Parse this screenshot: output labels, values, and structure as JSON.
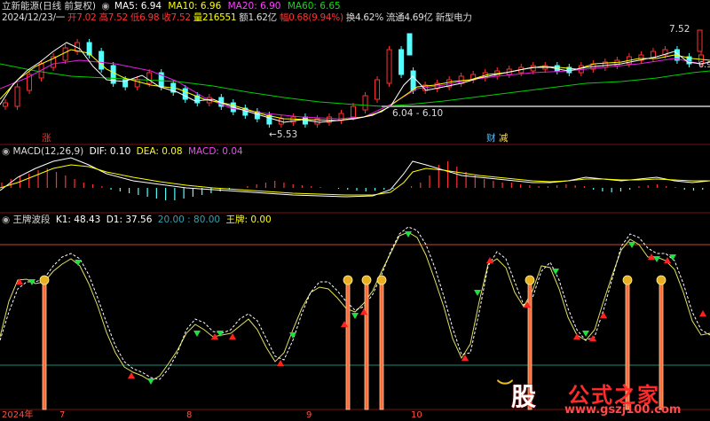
{
  "stock": {
    "title": "立新能源(日线 前复权)",
    "ma5_label": "MA5: 6.94",
    "ma10_label": "MA10: 6.96",
    "ma20_label": "MA20: 6.90",
    "ma60_label": "MA60: 6.65",
    "date": "2024/12/23/一",
    "open": "开7.02",
    "high": "高7.52",
    "low": "低6.98",
    "close": "收7.52",
    "volume": "量216551",
    "amount": "额1.62亿",
    "change": "幅0.68(9.94%)",
    "turnover": "换4.62%",
    "float_cap": "流通4.69亿",
    "sector": "新型电力",
    "price_high_label": "7.52",
    "price_right_label": "6.9",
    "low_label_1": "5.53",
    "low_label_2": "6.04 - 6.10",
    "marker_zhang": "涨",
    "marker_cai": "财",
    "marker_jian": "减"
  },
  "macd": {
    "title": "MACD(12,26,9)",
    "dif": "DIF: 0.10",
    "dea": "DEA: 0.08",
    "macd": "MACD: 0.04"
  },
  "wangpai": {
    "title": "王牌波段",
    "k1": "K1: 48.43",
    "d1": "D1: 37.56",
    "levels": "20.00 : 80.00",
    "wangpai": "王牌: 0.00"
  },
  "xaxis": {
    "year": "2024年",
    "m7": "7",
    "m8": "8",
    "m9": "9",
    "m10": "10"
  },
  "watermark": {
    "logo": "股",
    "name": "公式之家",
    "url": "www.gszj100.com"
  },
  "colors": {
    "up": "#ff3232",
    "down": "#54ffff",
    "ma5": "#ffffff",
    "ma10": "#ffff00",
    "ma20": "#ff00ff",
    "ma60": "#00e600",
    "background": "#000000"
  }
}
